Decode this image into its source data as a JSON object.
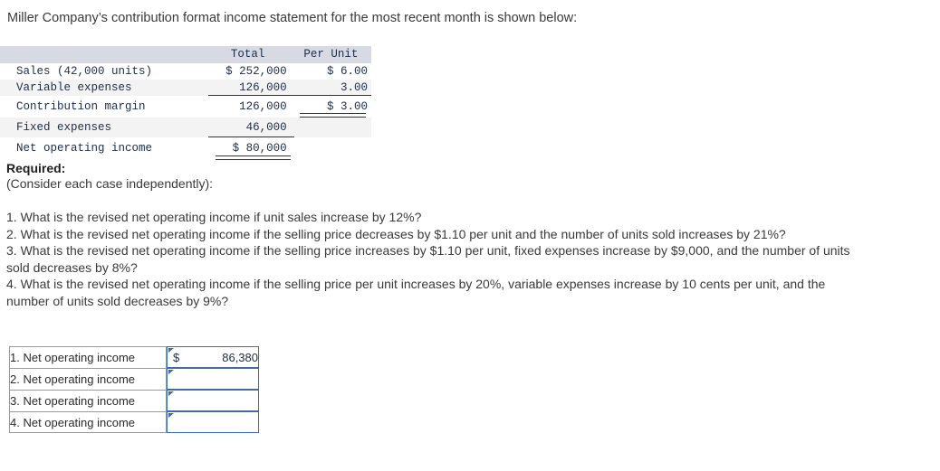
{
  "intro": "Miller Company’s contribution format income statement for the most recent month is shown below:",
  "statement": {
    "headers": {
      "label": "",
      "total": "Total",
      "per_unit": "Per Unit"
    },
    "rows": [
      {
        "label": "Sales (42,000 units)",
        "total": "$ 252,000",
        "per_unit": "$ 6.00"
      },
      {
        "label": "Variable expenses",
        "total": "126,000",
        "per_unit": "3.00"
      },
      {
        "label": "Contribution margin",
        "total": "126,000",
        "per_unit": "$ 3.00"
      },
      {
        "label": "Fixed expenses",
        "total": "46,000",
        "per_unit": ""
      },
      {
        "label": "Net operating income",
        "total": "$ 80,000",
        "per_unit": ""
      }
    ]
  },
  "required": {
    "title": "Required:",
    "subtitle": "(Consider each case independently):"
  },
  "questions": [
    "1. What is the revised net operating income if unit sales increase by 12%?",
    "2. What is the revised net operating income if the selling price decreases by $1.10 per unit and the number of units sold increases by 21%?",
    "3. What is the revised net operating income if the selling price increases by $1.10 per unit, fixed expenses increase by $9,000, and the number of units sold decreases by 8%?",
    "4. What is the revised net operating income if the selling price per unit increases by 20%, variable expenses increase by 10 cents per unit, and the number of units sold decreases by 9%?"
  ],
  "answers": {
    "rows": [
      {
        "label": "1. Net operating income",
        "currency": "$",
        "value": "86,380"
      },
      {
        "label": "2. Net operating income",
        "currency": "",
        "value": ""
      },
      {
        "label": "3. Net operating income",
        "currency": "",
        "value": ""
      },
      {
        "label": "4. Net operating income",
        "currency": "",
        "value": ""
      }
    ]
  },
  "colors": {
    "header_band": "#d7dae2",
    "shade_row": "#f3f3f3",
    "input_border": "#3a6ea5",
    "label_border": "#9a9a9a",
    "statement_text": "#1d2d4a"
  }
}
